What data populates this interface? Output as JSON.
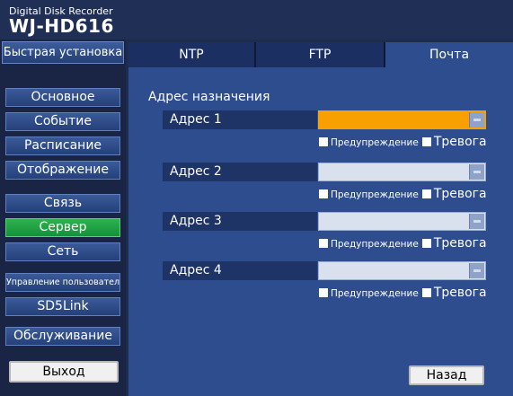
{
  "header": {
    "product": "Digital Disk Recorder",
    "model": "WJ-HD616"
  },
  "sidebar": {
    "quick_setup": "Быстрая установка",
    "items": [
      {
        "label": "Основное",
        "active": false
      },
      {
        "label": "Событие",
        "active": false
      },
      {
        "label": "Расписание",
        "active": false
      },
      {
        "label": "Отображение",
        "active": false
      },
      {
        "label": "Связь",
        "active": false
      },
      {
        "label": "Сервер",
        "active": true
      },
      {
        "label": "Сеть",
        "active": false
      },
      {
        "label": "Управление пользователем",
        "active": false
      },
      {
        "label": "SD5Link",
        "active": false
      },
      {
        "label": "Обслуживание",
        "active": false
      }
    ],
    "exit": "Выход"
  },
  "tabs": [
    {
      "label": "NTP",
      "active": false
    },
    {
      "label": "FTP",
      "active": false
    },
    {
      "label": "Почта",
      "active": true
    }
  ],
  "mail": {
    "section_title": "Адрес назначения",
    "addresses": [
      {
        "label": "Адрес 1",
        "value": "",
        "warning_label": "Предупреждение",
        "alarm_label": "Тревога"
      },
      {
        "label": "Адрес 2",
        "value": "",
        "warning_label": "Предупреждение",
        "alarm_label": "Тревога"
      },
      {
        "label": "Адрес 3",
        "value": "",
        "warning_label": "Предупреждение",
        "alarm_label": "Тревога"
      },
      {
        "label": "Адрес 4",
        "value": "",
        "warning_label": "Предупреждение",
        "alarm_label": "Тревога"
      }
    ]
  },
  "buttons": {
    "back": "Назад"
  },
  "colors": {
    "active_field": "#f7a000",
    "active_sidebar": "#13913a",
    "background": "#1d2e54"
  }
}
